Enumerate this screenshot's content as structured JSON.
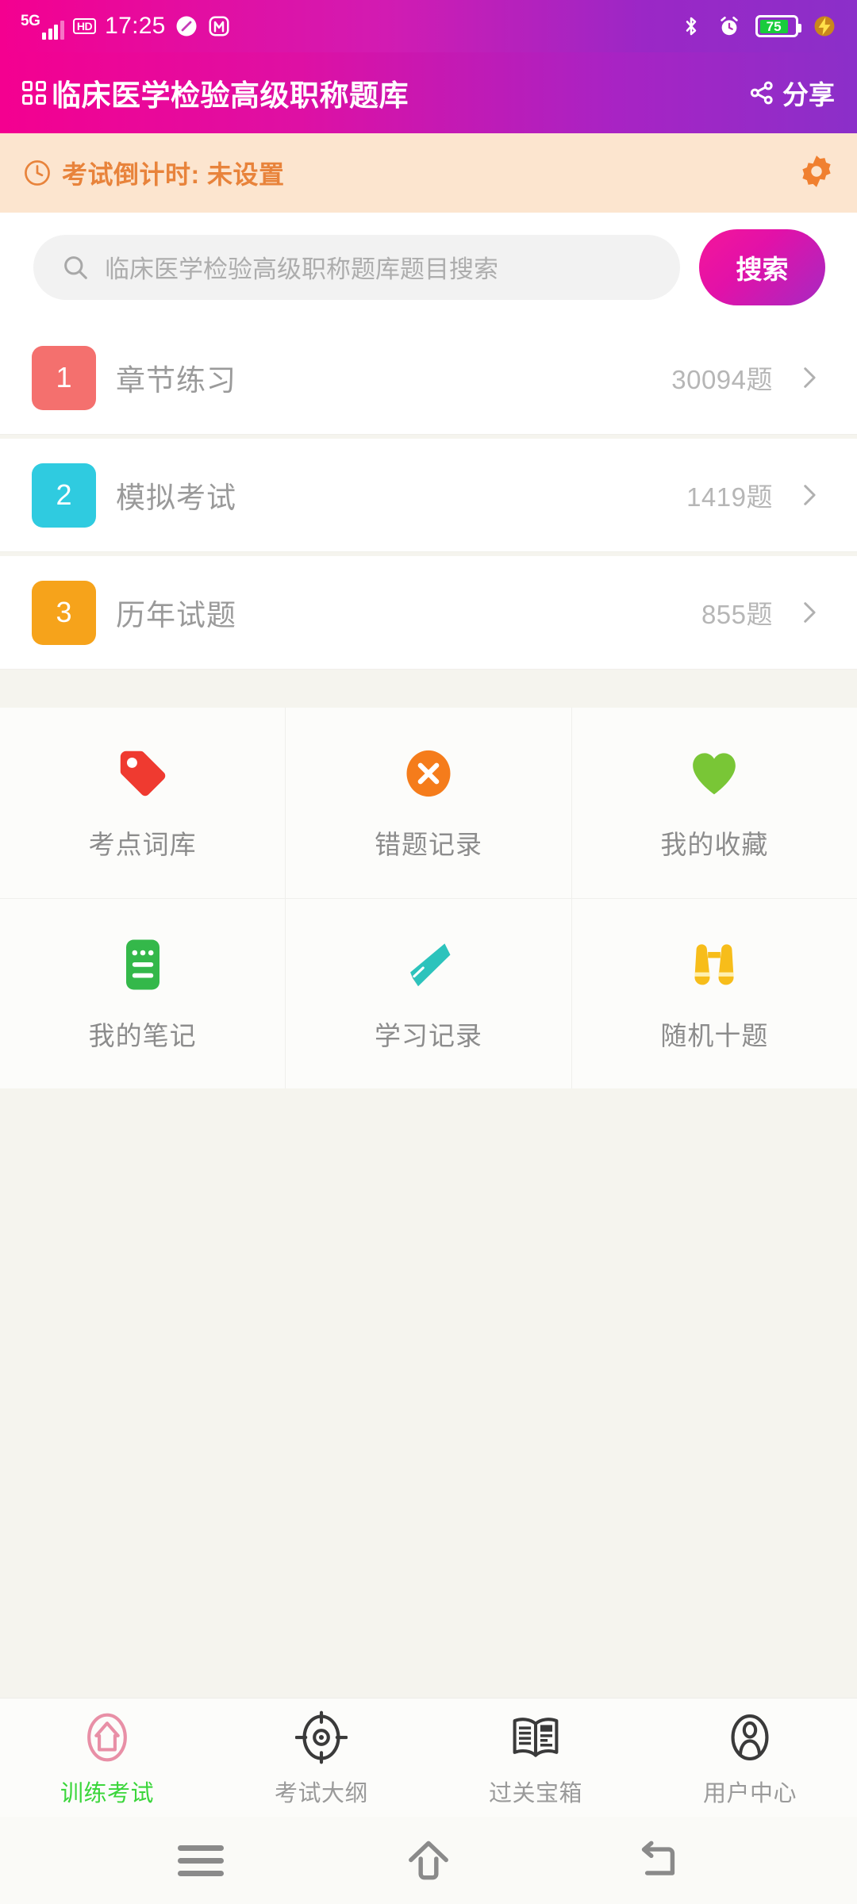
{
  "status_bar": {
    "network_label": "5G",
    "voice_badge": "HD",
    "time": "17:25",
    "battery_percent": "75",
    "icons": [
      "5g-signal-icon",
      "hd-icon",
      "compass-icon",
      "m-app-icon",
      "bluetooth-icon",
      "alarm-icon",
      "battery-icon",
      "fast-charge-icon"
    ]
  },
  "header": {
    "title": "临床医学检验高级职称题库",
    "grid_icon": "grid-icon",
    "share_label": "分享",
    "share_icon": "share-icon",
    "gradient_start": "#F40090",
    "gradient_end": "#8B2FC9"
  },
  "countdown": {
    "clock_icon": "clock-icon",
    "text": "考试倒计时: 未设置",
    "settings_icon": "gear-icon",
    "background": "#FCE5CF",
    "text_color": "#E8833B",
    "icon_color": "#F08030"
  },
  "search": {
    "placeholder": "临床医学检验高级职称题库题目搜索",
    "value": "",
    "search_icon": "search-icon",
    "button_label": "搜索"
  },
  "list_rows": [
    {
      "number": "1",
      "label": "章节练习",
      "count": "30094题",
      "color": "#F4706E",
      "chevron_icon": "chevron-right-icon"
    },
    {
      "number": "2",
      "label": "模拟考试",
      "count": "1419题",
      "color": "#2FCBE0",
      "chevron_icon": "chevron-right-icon"
    },
    {
      "number": "3",
      "label": "历年试题",
      "count": "855题",
      "color": "#F6A31B",
      "chevron_icon": "chevron-right-icon"
    }
  ],
  "icon_grid": [
    [
      {
        "label": "考点词库",
        "icon": "tag-icon",
        "color": "#EF3A30"
      },
      {
        "label": "错题记录",
        "icon": "cross-circle-icon",
        "color": "#F57C1B"
      },
      {
        "label": "我的收藏",
        "icon": "heart-icon",
        "color": "#79C636"
      }
    ],
    [
      {
        "label": "我的笔记",
        "icon": "notebook-icon",
        "color": "#34B84A"
      },
      {
        "label": "学习记录",
        "icon": "pencil-icon",
        "color": "#2CC3BC"
      },
      {
        "label": "随机十题",
        "icon": "binoculars-icon",
        "color": "#F7BD1A"
      }
    ]
  ],
  "tab_bar": {
    "active_index": 0,
    "active_color": "#3BD63B",
    "items": [
      {
        "label": "训练考试",
        "icon": "home-exam-icon",
        "icon_color": "#E88FA6"
      },
      {
        "label": "考试大纲",
        "icon": "target-icon",
        "icon_color": "#3A3A3A"
      },
      {
        "label": "过关宝箱",
        "icon": "open-book-icon",
        "icon_color": "#3A3A3A"
      },
      {
        "label": "用户中心",
        "icon": "user-circle-icon",
        "icon_color": "#3A3A3A"
      }
    ]
  },
  "android_nav": {
    "items": [
      {
        "name": "menu-icon"
      },
      {
        "name": "home-icon"
      },
      {
        "name": "back-icon"
      }
    ]
  }
}
